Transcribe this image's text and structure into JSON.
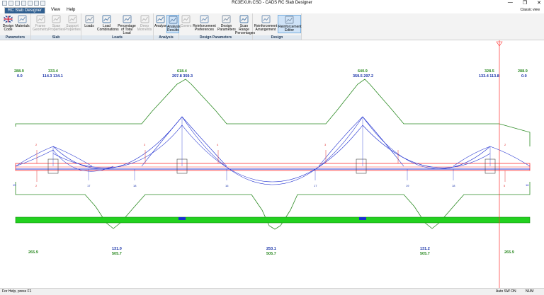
{
  "window": {
    "title": "RC3EXUh.CSD - CADS RC Slab Designer",
    "controls": [
      "—",
      "❐",
      "✕"
    ]
  },
  "tabs": [
    {
      "label": "RC Slab Designer",
      "active": true
    },
    {
      "label": "View",
      "active": false
    },
    {
      "label": "Help",
      "active": false
    }
  ],
  "classic_view": "Classic view",
  "ribbon": {
    "groups": [
      {
        "label": "Parameters",
        "buttons": [
          {
            "label": "Design\nCode",
            "icon": "flag-icon",
            "state": "enabled"
          },
          {
            "label": "Materials",
            "icon": "materials-icon",
            "state": "enabled"
          }
        ]
      },
      {
        "label": "Slab",
        "buttons": [
          {
            "label": "Frame\nGeometry",
            "icon": "frame-icon",
            "state": "disabled"
          },
          {
            "label": "Span\nProperties",
            "icon": "span-icon",
            "state": "disabled"
          },
          {
            "label": "Support\nProperties",
            "icon": "support-icon",
            "state": "disabled"
          }
        ]
      },
      {
        "label": "Loads",
        "buttons": [
          {
            "label": "Loads",
            "icon": "loads-icon",
            "state": "enabled"
          },
          {
            "label": "Load\nCombinations",
            "icon": "combinations-icon",
            "state": "enabled"
          },
          {
            "label": "Percentage\nof Total Load",
            "icon": "percentage-icon",
            "state": "enabled"
          },
          {
            "label": "Deep\nMoments",
            "icon": "deep-moments-icon",
            "state": "disabled"
          }
        ]
      },
      {
        "label": "Analysis",
        "buttons": [
          {
            "label": "Analyse",
            "icon": "analyse-icon",
            "state": "enabled"
          },
          {
            "label": "Analysis\nResults",
            "icon": "results-icon",
            "state": "selected"
          }
        ]
      },
      {
        "label": "Design Parameters",
        "buttons": [
          {
            "label": "Covers",
            "icon": "covers-icon",
            "state": "disabled"
          },
          {
            "label": "Reinforcement\nPreferences",
            "icon": "preferences-icon",
            "state": "enabled"
          },
          {
            "label": "Design\nParameters",
            "icon": "design-params-icon",
            "state": "enabled"
          },
          {
            "label": "Scan Range\nPercentages",
            "icon": "scan-range-icon",
            "state": "enabled"
          }
        ]
      },
      {
        "label": "Design",
        "buttons": [
          {
            "label": "Reinforcement\nArrangement",
            "icon": "arrangement-icon",
            "state": "enabled"
          },
          {
            "label": "Reinforcement\nEditor",
            "icon": "editor-icon",
            "state": "selected"
          }
        ]
      }
    ]
  },
  "diagram": {
    "top_labels": [
      {
        "green": "288.9",
        "blue": "0.0"
      },
      {
        "green": "333.4",
        "blue": "114.3 134.1"
      },
      {
        "green": "618.4",
        "blue": "297.8 359.3"
      },
      {
        "green": "640.9",
        "blue": "359.5 297.2"
      },
      {
        "green": "328.5",
        "blue": "133.4 113.8"
      },
      {
        "green": "288.9",
        "blue": "0.0"
      }
    ],
    "bottom_labels": [
      {
        "green": "265.9"
      },
      {
        "blue": "131.0",
        "green": "505.7"
      },
      {
        "blue": "253.1",
        "green": "505.7"
      },
      {
        "blue": "131.2",
        "green": "505.7"
      },
      {
        "green": "265.9"
      }
    ],
    "section_marks_top": [
      "2",
      "3",
      "4",
      "3",
      "2"
    ],
    "section_marks_bottom": [
      "2",
      "17",
      "18",
      "16",
      "17",
      "19",
      "18",
      "5"
    ],
    "end_marks": [
      "15",
      "16"
    ]
  },
  "status": {
    "left": "For Help, press F1",
    "right": [
      "Auto SW ON",
      "NUM"
    ]
  }
}
